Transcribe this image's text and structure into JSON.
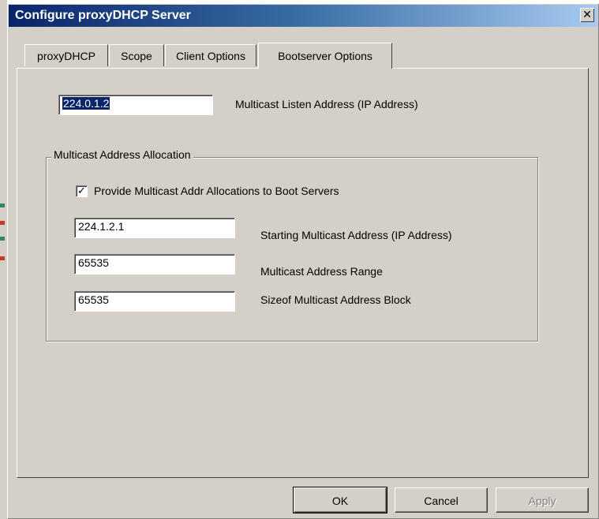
{
  "window": {
    "title": "Configure proxyDHCP Server",
    "close_glyph": "✕"
  },
  "tabs": [
    {
      "label": "proxyDHCP",
      "active": false
    },
    {
      "label": "Scope",
      "active": false
    },
    {
      "label": "Client Options",
      "active": false
    },
    {
      "label": "Bootserver Options",
      "active": true
    }
  ],
  "multicast_listen": {
    "value": "224.0.1.2",
    "label": "Multicast Listen Address (IP Address)"
  },
  "allocation_group": {
    "title": "Multicast Address Allocation",
    "checkbox_label": "Provide Multicast Addr Allocations to Boot Servers",
    "checkbox_glyph": "✓",
    "checked": true,
    "fields": [
      {
        "value": "224.1.2.1",
        "label": "Starting Multicast Address (IP Address)"
      },
      {
        "value": "65535",
        "label": "Multicast Address Range"
      },
      {
        "value": "65535",
        "label": "Sizeof Multicast Address Block"
      }
    ]
  },
  "buttons": {
    "ok": "OK",
    "cancel": "Cancel",
    "apply": "Apply"
  },
  "colors": {
    "face": "#d4d0c8",
    "title_start": "#0a246a",
    "selection": "#0a246a"
  }
}
